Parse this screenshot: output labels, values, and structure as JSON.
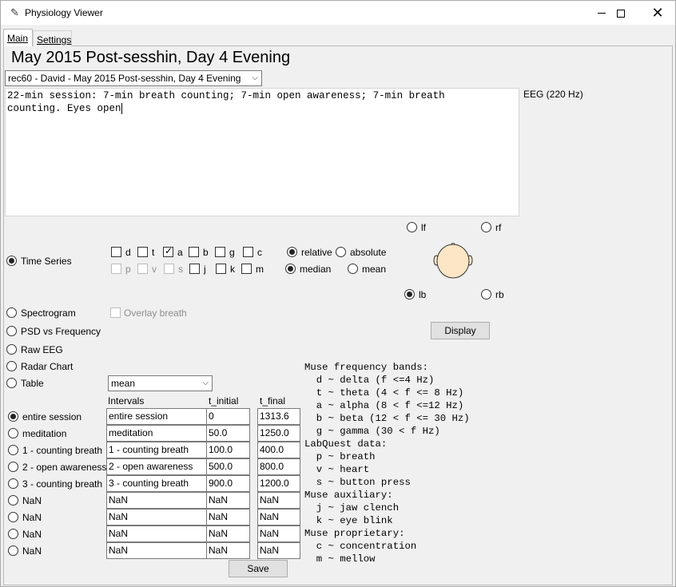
{
  "window": {
    "title": "Physiology Viewer",
    "close_glyph": "✕"
  },
  "tabs": [
    {
      "label": "Main",
      "selected": true
    },
    {
      "label": "Settings",
      "selected": false
    }
  ],
  "main": {
    "title": "May 2015 Post-sesshin, Day 4 Evening",
    "recording_select": "rec60 - David - May 2015 Post-sesshin, Day 4 Evening",
    "notes": "22-min session: 7-min breath counting; 7-min open awareness; 7-min breath\ncounting. Eyes open",
    "eeg_label": "EEG (220 Hz)"
  },
  "plot_types": {
    "time_series": "Time Series",
    "spectrogram": "Spectrogram",
    "psd": "PSD vs Frequency",
    "raw_eeg": "Raw EEG",
    "radar": "Radar Chart",
    "table": "Table",
    "selected": "time_series"
  },
  "bands": {
    "d": "d",
    "t": "t",
    "a": "a",
    "b": "b",
    "g": "g",
    "c": "c",
    "p": "p",
    "v": "v",
    "s": "s",
    "j": "j",
    "k": "k",
    "m": "m",
    "checked": [
      "a"
    ],
    "disabled": [
      "p",
      "v",
      "s"
    ]
  },
  "scale": {
    "relative": "relative",
    "absolute": "absolute",
    "selected": "relative"
  },
  "stat": {
    "median": "median",
    "mean": "mean",
    "selected": "median"
  },
  "overlay_breath": "Overlay breath",
  "table_stat": "mean",
  "sensors": {
    "lf": "lf",
    "rf": "rf",
    "lb": "lb",
    "rb": "rb",
    "selected": "lb"
  },
  "display_button": "Display",
  "intervals": {
    "col_intervals": "Intervals",
    "col_t_initial": "t_initial",
    "col_t_final": "t_final",
    "selected_index": 0,
    "rows": [
      {
        "radio": "entire session",
        "name": "entire session",
        "t_initial": "0",
        "t_final": "1313.6"
      },
      {
        "radio": "meditation",
        "name": "meditation",
        "t_initial": "50.0",
        "t_final": "1250.0"
      },
      {
        "radio": "1 - counting breath",
        "name": "1 - counting breath",
        "t_initial": "100.0",
        "t_final": "400.0"
      },
      {
        "radio": "2 - open awareness",
        "name": "2 - open awareness",
        "t_initial": "500.0",
        "t_final": "800.0"
      },
      {
        "radio": "3 - counting breath",
        "name": "3 - counting breath",
        "t_initial": "900.0",
        "t_final": "1200.0"
      },
      {
        "radio": "NaN",
        "name": "NaN",
        "t_initial": "NaN",
        "t_final": "NaN"
      },
      {
        "radio": "NaN",
        "name": "NaN",
        "t_initial": "NaN",
        "t_final": "NaN"
      },
      {
        "radio": "NaN",
        "name": "NaN",
        "t_initial": "NaN",
        "t_final": "NaN"
      },
      {
        "radio": "NaN",
        "name": "NaN",
        "t_initial": "NaN",
        "t_final": "NaN"
      }
    ]
  },
  "save_button": "Save",
  "legend": [
    "Muse frequency bands:",
    "  d ~ delta (f <=4 Hz)",
    "  t ~ theta (4 < f <= 8 Hz)",
    "  a ~ alpha (8 < f <=12 Hz)",
    "  b ~ beta (12 < f <= 30 Hz)",
    "  g ~ gamma (30 < f Hz)",
    "LabQuest data:",
    "  p ~ breath",
    "  v ~ heart",
    "  s ~ button press",
    "Muse auxiliary:",
    "  j ~ jaw clench",
    "  k ~ eye blink",
    "Muse proprietary:",
    "  c ~ concentration",
    "  m ~ mellow"
  ]
}
